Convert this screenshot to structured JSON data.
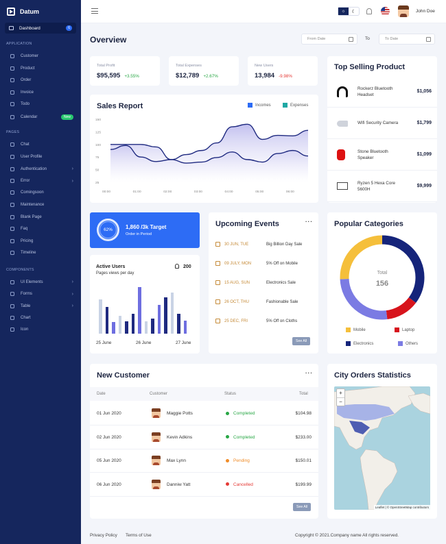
{
  "brand": {
    "name": "Datum"
  },
  "sidebar": {
    "dashboard": {
      "label": "Dashboard",
      "count": "6"
    },
    "sections": {
      "application": "APPLICATION",
      "pages": "PAGES",
      "components": "COMPONENTS"
    },
    "application": [
      {
        "label": "Customer"
      },
      {
        "label": "Product"
      },
      {
        "label": "Order"
      },
      {
        "label": "Invoice"
      },
      {
        "label": "Todo"
      },
      {
        "label": "Calendar",
        "badge": "New"
      }
    ],
    "pages": [
      {
        "label": "Chat"
      },
      {
        "label": "User Profile"
      },
      {
        "label": "Authentication"
      },
      {
        "label": "Error"
      },
      {
        "label": "Comingsoon"
      },
      {
        "label": "Maintenance"
      },
      {
        "label": "Blank Page"
      },
      {
        "label": "Faq"
      },
      {
        "label": "Pricing"
      },
      {
        "label": "Timeline"
      }
    ],
    "components": [
      {
        "label": "UI Elements"
      },
      {
        "label": "Forms"
      },
      {
        "label": "Table"
      },
      {
        "label": "Chart"
      },
      {
        "label": "Icon"
      }
    ]
  },
  "header": {
    "user_name": "John Doe",
    "theme_light": "☼",
    "theme_dark": "☾"
  },
  "overview": {
    "title": "Overview",
    "from_placeholder": "From Date",
    "to_label": "To",
    "to_placeholder": "To Date"
  },
  "stats": [
    {
      "label": "Total Profit",
      "value": "$95,595",
      "change": "+3.55%",
      "color": "#28a745"
    },
    {
      "label": "Total Expenses",
      "value": "$12,789",
      "change": "+2.67%",
      "color": "#28a745"
    },
    {
      "label": "New Users",
      "value": "13,984",
      "change": "-9.98%",
      "color": "#e53935"
    }
  ],
  "sales_report": {
    "title": "Sales Report",
    "legend": [
      "Incomes",
      "Expenses"
    ],
    "yticks": [
      "150",
      "125",
      "100",
      "75",
      "50",
      "25"
    ],
    "xticks": [
      "00:00",
      "01:00",
      "02:00",
      "03:00",
      "04:00",
      "05:00",
      "06:00"
    ]
  },
  "chart_data": {
    "type": "area",
    "title": "Sales Report",
    "categories": [
      "00:00",
      "00:30",
      "01:00",
      "01:30",
      "02:00",
      "02:30",
      "03:00",
      "03:30",
      "04:00",
      "04:30",
      "05:00",
      "05:30",
      "06:00",
      "06:30"
    ],
    "series": [
      {
        "name": "Incomes",
        "values": [
          90,
          98,
          75,
          66,
          70,
          80,
          88,
          103,
          135,
          140,
          110,
          118,
          117,
          128
        ]
      },
      {
        "name": "Expenses",
        "values": [
          100,
          100,
          100,
          95,
          70,
          63,
          65,
          74,
          85,
          70,
          65,
          82,
          88,
          77
        ]
      }
    ],
    "ylim": [
      25,
      150
    ],
    "colors": {
      "Incomes": "#2d6cf5",
      "Expenses": "#1fa8a4",
      "line": "#1f2a80",
      "fill": "#b8b5ec"
    }
  },
  "top_selling": {
    "title": "Top Selling Product",
    "items": [
      {
        "name": "Rockerz Bluetooth Headset",
        "price": "$1,056",
        "icon": "headset-icon"
      },
      {
        "name": "Wifi Security Camera",
        "price": "$1,799",
        "icon": "camera-icon"
      },
      {
        "name": "Stone Bluetooth Speaker",
        "price": "$1,099",
        "icon": "speaker-icon"
      },
      {
        "name": "Ryzen 5 Hexa Core 5600H",
        "price": "$9,999",
        "icon": "laptop-icon"
      }
    ]
  },
  "target": {
    "percent": "62%",
    "title": "1,860 /3k Target",
    "subtitle": "Order in Period"
  },
  "active_users": {
    "title": "Active Users",
    "subtitle": "Pages views per day",
    "count": "200",
    "dates": [
      "25 June",
      "26 June",
      "27 June"
    ],
    "bars": [
      {
        "v": 0.73,
        "c": "#c9d3e5"
      },
      {
        "v": 0.58,
        "c": "#1f2a80"
      },
      {
        "v": 0.25,
        "c": "#6e6ee0"
      },
      {
        "v": 0.38,
        "c": "#c9d3e5"
      },
      {
        "v": 0.27,
        "c": "#1f2a80"
      },
      {
        "v": 0.43,
        "c": "#1f2a80"
      },
      {
        "v": 1.0,
        "c": "#6e6ee0"
      },
      {
        "v": 0.27,
        "c": "#c9d3e5"
      },
      {
        "v": 0.33,
        "c": "#1f2a80"
      },
      {
        "v": 0.62,
        "c": "#6e6ee0"
      },
      {
        "v": 0.78,
        "c": "#1f2a80"
      },
      {
        "v": 0.88,
        "c": "#c9d3e5"
      },
      {
        "v": 0.42,
        "c": "#1f2a80"
      },
      {
        "v": 0.28,
        "c": "#6e6ee0"
      }
    ]
  },
  "events": {
    "title": "Upcoming Events",
    "see_all": "See All",
    "items": [
      {
        "date": "30 JUN, TUE",
        "title": "Big Billion Day Sale"
      },
      {
        "date": "09 JULY, MON",
        "title": "5% Off on Mobile"
      },
      {
        "date": "15 AUG, SUN",
        "title": "Electronics Sale"
      },
      {
        "date": "26 OCT, THU",
        "title": "Fashionable Sale"
      },
      {
        "date": "25 DEC, FRI",
        "title": "5% Off on Cloths"
      }
    ]
  },
  "categories": {
    "title": "Popular Categories",
    "total_label": "Total",
    "total": "156",
    "slices": [
      {
        "name": "Mobile",
        "value": 40,
        "color": "#f5bf3b"
      },
      {
        "name": "Electronics",
        "value": 55,
        "color": "#15247a"
      },
      {
        "name": "Laptop",
        "value": 20,
        "color": "#d7141c"
      },
      {
        "name": "Others",
        "value": 41,
        "color": "#7b7be3"
      }
    ]
  },
  "customers": {
    "title": "New Customer",
    "see_all": "See All",
    "columns": [
      "Date",
      "Customer",
      "Status",
      "Total"
    ],
    "rows": [
      {
        "date": "01 Jun 2020",
        "name": "Maggie Potts",
        "status": "Completed",
        "status_color": "#28a745",
        "total": "$104.98"
      },
      {
        "date": "02 Jun 2020",
        "name": "Kevin Adkins",
        "status": "Completed",
        "status_color": "#28a745",
        "total": "$233.00"
      },
      {
        "date": "05 Jun 2020",
        "name": "Max Lynn",
        "status": "Pending",
        "status_color": "#f08c28",
        "total": "$150.01"
      },
      {
        "date": "06 Jun 2020",
        "name": "Danniw Yatt",
        "status": "Cancelled",
        "status_color": "#e53935",
        "total": "$199.99"
      }
    ]
  },
  "city_orders": {
    "title": "City Orders Statistics",
    "attribution": "Leaflet | © OpenStreetMap contributors",
    "zoom_in": "+",
    "zoom_out": "−"
  },
  "footer": {
    "privacy": "Privacy Policy",
    "terms": "Terms of Use",
    "copyright": "Copyright © 2021.Company name All rights reserved."
  }
}
